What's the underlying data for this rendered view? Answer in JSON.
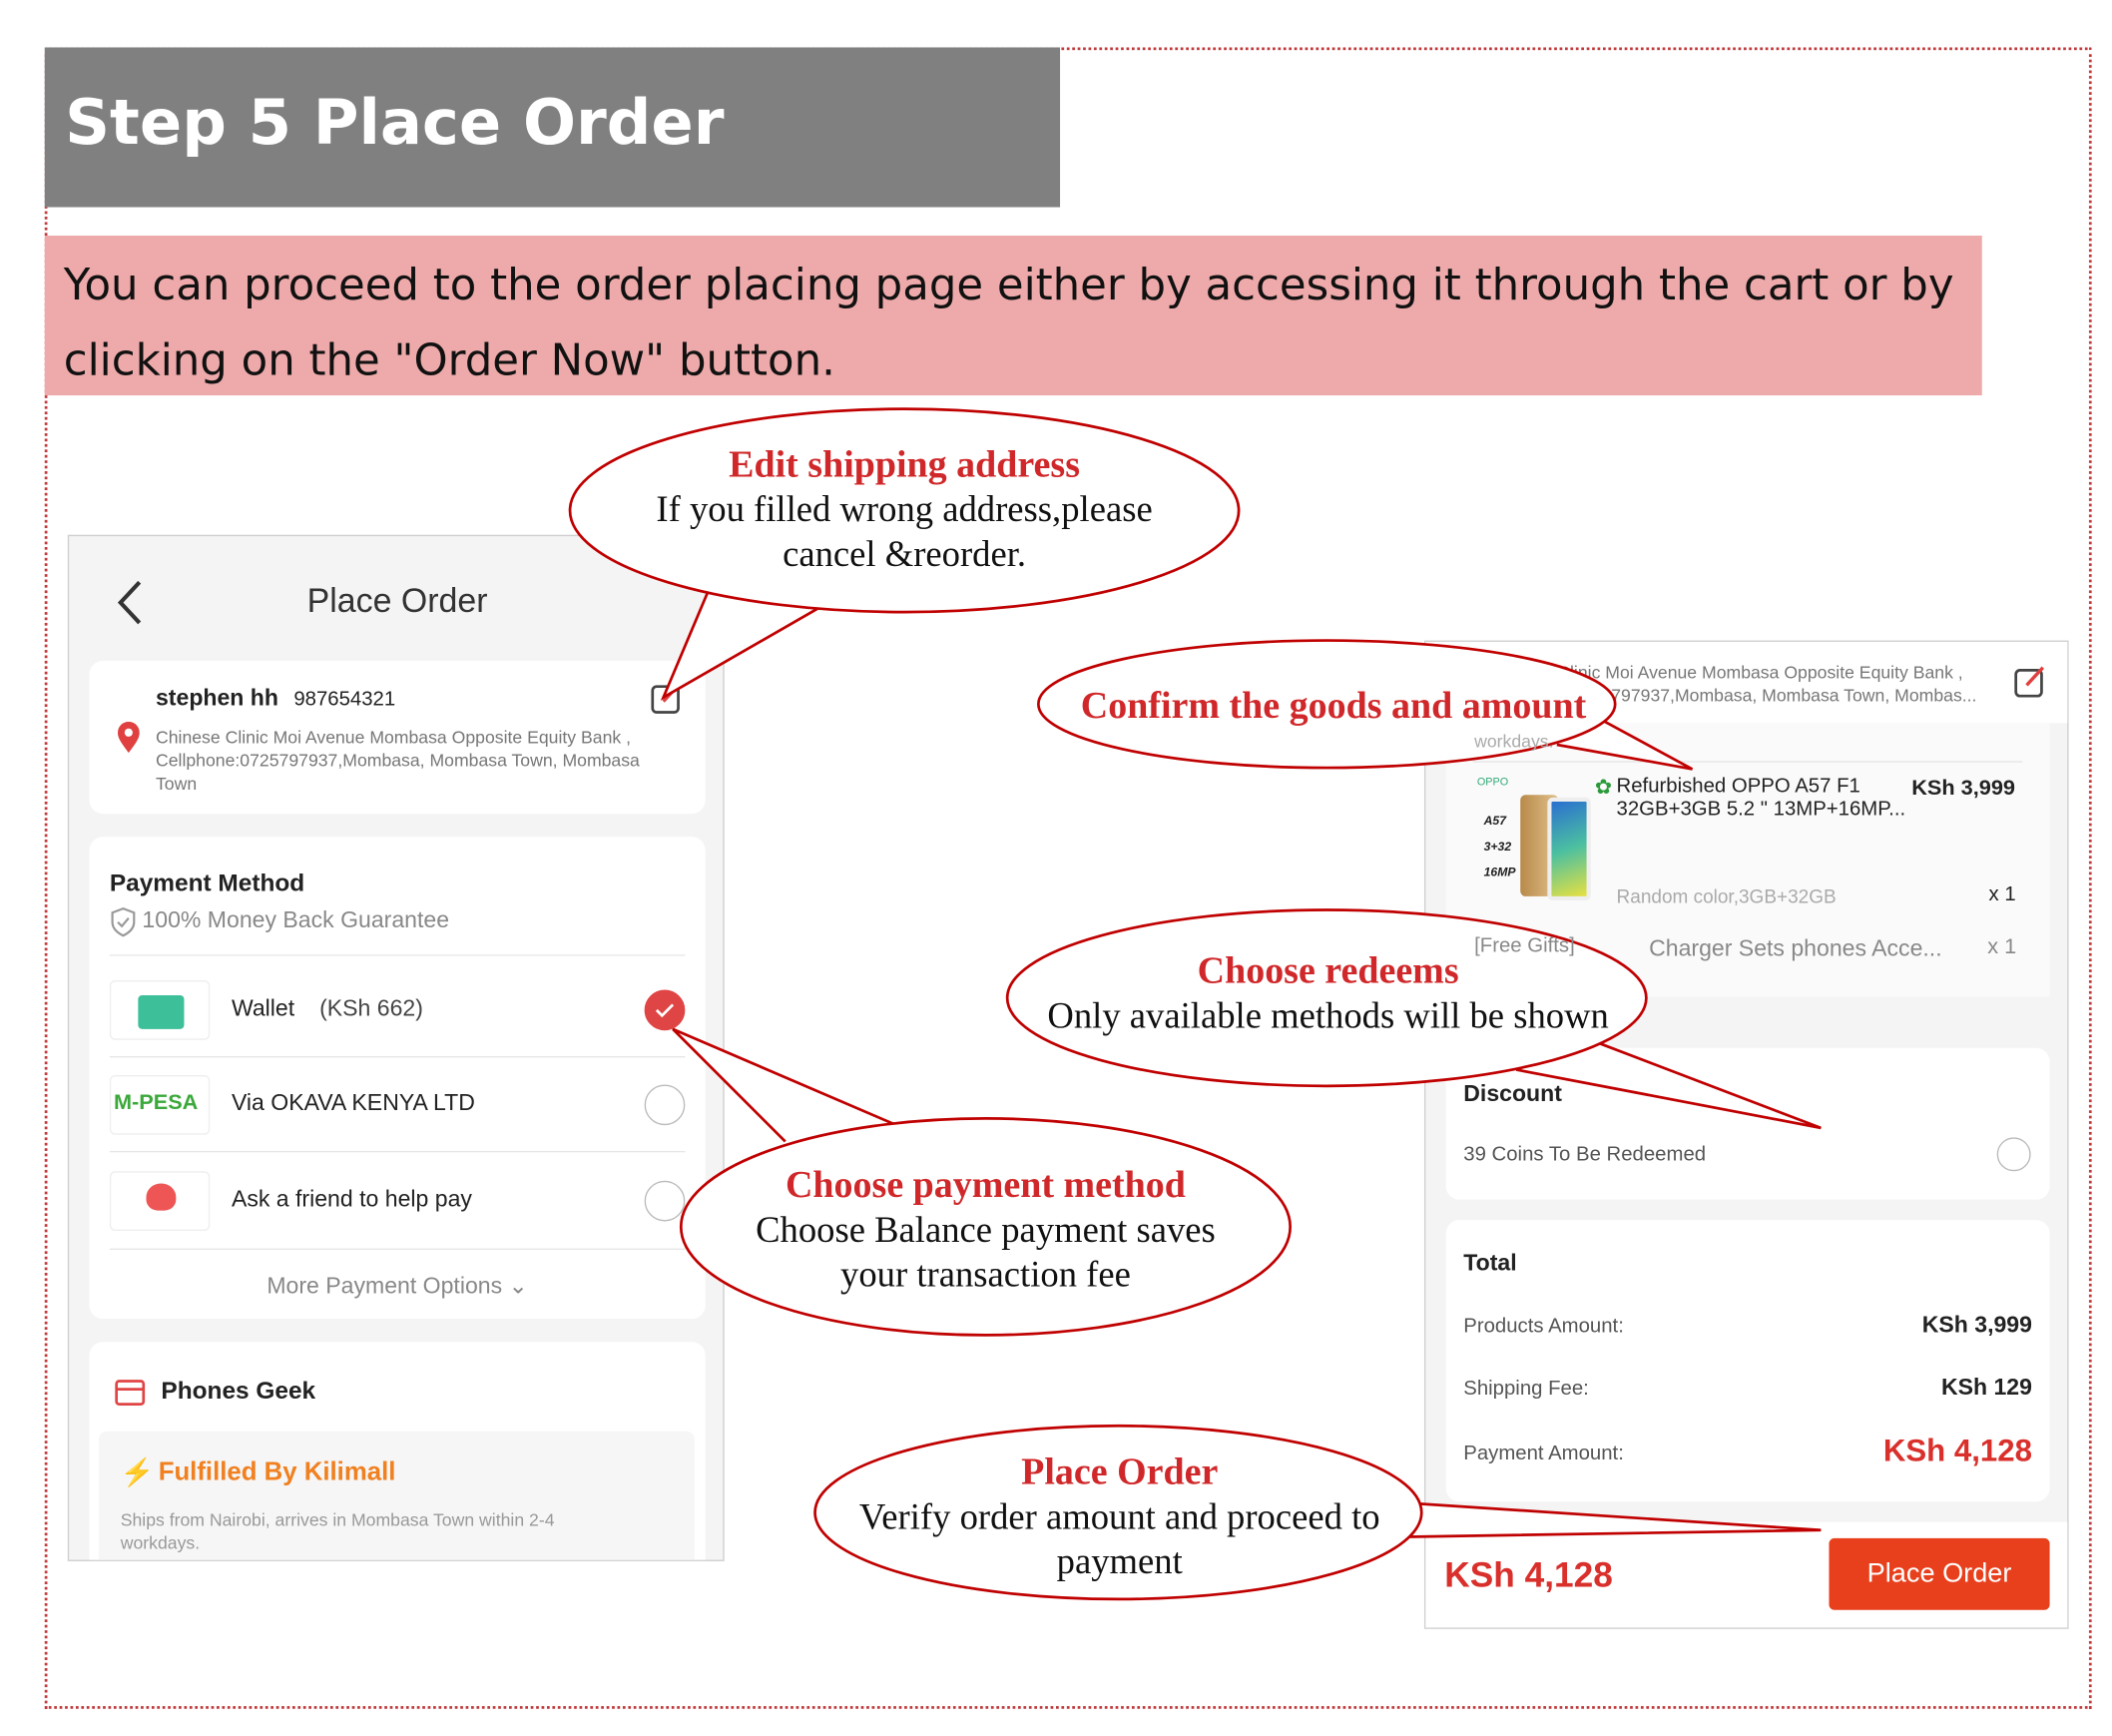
{
  "header": {
    "title": "Step 5 Place Order",
    "intro": "You can proceed to the order placing page either by accessing it through the  cart or by clicking on the \"Order Now\" button."
  },
  "left_screen": {
    "title": "Place Order",
    "address": {
      "name": "stephen hh",
      "phone": "987654321",
      "line1": "Chinese Clinic Moi Avenue Mombasa Opposite Equity Bank ,",
      "line2": "Cellphone:0725797937,Mombasa, Mombasa Town, Mombasa",
      "line3": "Town"
    },
    "payment": {
      "title": "Payment Method",
      "guarantee": "100% Money Back Guarantee",
      "options": [
        {
          "label": "Wallet",
          "extra": "(KSh 662)",
          "selected": true,
          "icon": "wallet-icon"
        },
        {
          "label": "Via OKAVA KENYA LTD",
          "logo": "M-PESA",
          "selected": false
        },
        {
          "label": "Ask a friend to help pay",
          "selected": false,
          "icon": "friend-pay-icon"
        }
      ],
      "more": "More Payment Options"
    },
    "store": {
      "name": "Phones Geek",
      "fulfilled": "Fulfilled By Kilimall",
      "ships": "Ships from Nairobi, arrives in Mombasa Town within 2-4",
      "ships2": "workdays."
    }
  },
  "right_screen": {
    "address1": "Chinese Clinic Moi Avenue Mombasa Opposite Equity Bank ,",
    "address2": "Cellphone:0725797937,Mombasa, Mombasa Town, Mombas...",
    "workdays": "workdays.",
    "product": {
      "brand": "OPPO",
      "tags": [
        "A57",
        "3+32",
        "16MP"
      ],
      "name1": "Refurbished OPPO A57 F1",
      "name2": "32GB+3GB 5.2 \" 13MP+16MP...",
      "price": "KSh 3,999",
      "variant": "Random color,3GB+32GB",
      "qty": "x 1"
    },
    "gift": {
      "label": "[Free Gifts]",
      "name": "Charger Sets  phones Acce...",
      "qty": "x 1"
    },
    "discount": {
      "title": "Discount",
      "coins": "39 Coins To Be Redeemed"
    },
    "total": {
      "title": "Total",
      "products_label": "Products Amount:",
      "products": "KSh 3,999",
      "shipping_label": "Shipping Fee:",
      "shipping": "KSh 129",
      "payment_label": "Payment Amount:",
      "payment": "KSh 4,128"
    },
    "bottom": {
      "amount": "KSh 4,128",
      "button": "Place Order"
    }
  },
  "callouts": [
    {
      "title": "Edit shipping address",
      "body1": "If you filled wrong address,please",
      "body2": "cancel &reorder."
    },
    {
      "title": "Confirm the goods and amount"
    },
    {
      "title": "Choose redeems",
      "body1": "Only available methods will be shown"
    },
    {
      "title": "Choose payment method",
      "body1": "Choose Balance payment saves",
      "body2": "your transaction fee"
    },
    {
      "title": "Place Order",
      "body1": "Verify order amount and proceed to",
      "body2": "payment"
    }
  ],
  "colors": {
    "accent": "#e8401c",
    "price_red": "#d9302c",
    "callout": "#c00000",
    "wallet": "#3dbf9a",
    "title_bg": "#808080",
    "intro_bg": "#eeaaaa"
  }
}
